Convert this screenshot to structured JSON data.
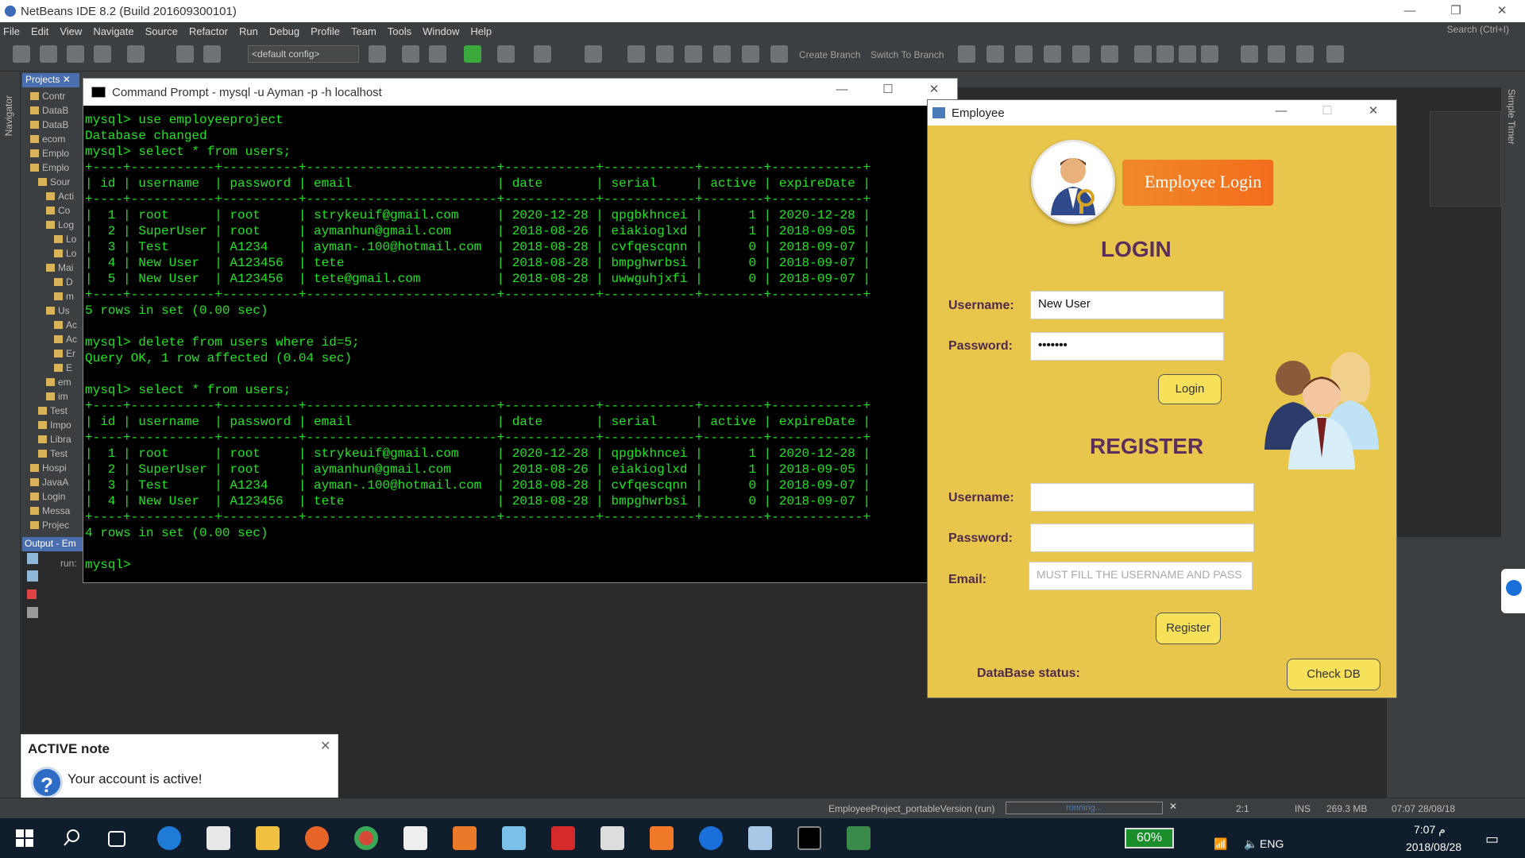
{
  "netbeans": {
    "title": "NetBeans IDE 8.2 (Build 201609300101)",
    "menu": [
      "File",
      "Edit",
      "View",
      "Navigate",
      "Source",
      "Refactor",
      "Run",
      "Debug",
      "Profile",
      "Team",
      "Tools",
      "Window",
      "Help"
    ],
    "search_placeholder": "Search (Ctrl+I)",
    "config": "<default config>",
    "create_branch": "Create Branch",
    "switch_branch": "Switch To Branch",
    "projects_tab": "Projects",
    "navigator": "Navigator",
    "output_tab": "Output - Em",
    "output_run": "run:",
    "simple_timer": "Simple Timer",
    "tree": [
      "Contr",
      "DataB",
      "DataB",
      "ecom",
      "Emplo",
      "Emplo",
      "Sour",
      "Acti",
      "Co",
      "Log",
      "Lo",
      "Lo",
      "Mai",
      "D",
      "m",
      "Us",
      "Ac",
      "Ac",
      "Er",
      "E",
      "em",
      "im",
      "Test",
      "Impo",
      "Libra",
      "Test",
      "Hospi",
      "JavaA",
      "Login",
      "Messa",
      "Projec"
    ],
    "status_project": "EmployeeProject_portableVersion (run)",
    "status_running": "running...",
    "status_pos": "2:1",
    "status_ins": "INS",
    "status_mem": "269.3 MB",
    "status_time": "07:07 28/08/18"
  },
  "cmd": {
    "title": "Command Prompt - mysql  -u Ayman -p -h localhost",
    "lines": [
      "mysql> use employeeproject",
      "Database changed",
      "mysql> select * from users;",
      "+----+-----------+----------+-------------------------+------------+------------+--------+------------+",
      "| id | username  | password | email                   | date       | serial     | active | expireDate |",
      "+----+-----------+----------+-------------------------+------------+------------+--------+------------+",
      "|  1 | root      | root     | strykeuif@gmail.com     | 2020-12-28 | qpgbkhncei |      1 | 2020-12-28 |",
      "|  2 | SuperUser | root     | aymanhun@gmail.com      | 2018-08-26 | eiakioglxd |      1 | 2018-09-05 |",
      "|  3 | Test      | A1234    | ayman-.100@hotmail.com  | 2018-08-28 | cvfqescqnn |      0 | 2018-09-07 |",
      "|  4 | New User  | A123456  | tete                    | 2018-08-28 | bmpghwrbsi |      0 | 2018-09-07 |",
      "|  5 | New User  | A123456  | tete@gmail.com          | 2018-08-28 | uwwguhjxfi |      0 | 2018-09-07 |",
      "+----+-----------+----------+-------------------------+------------+------------+--------+------------+",
      "5 rows in set (0.00 sec)",
      "",
      "mysql> delete from users where id=5;",
      "Query OK, 1 row affected (0.04 sec)",
      "",
      "mysql> select * from users;",
      "+----+-----------+----------+-------------------------+------------+------------+--------+------------+",
      "| id | username  | password | email                   | date       | serial     | active | expireDate |",
      "+----+-----------+----------+-------------------------+------------+------------+--------+------------+",
      "|  1 | root      | root     | strykeuif@gmail.com     | 2020-12-28 | qpgbkhncei |      1 | 2020-12-28 |",
      "|  2 | SuperUser | root     | aymanhun@gmail.com      | 2018-08-26 | eiakioglxd |      1 | 2018-09-05 |",
      "|  3 | Test      | A1234    | ayman-.100@hotmail.com  | 2018-08-28 | cvfqescqnn |      0 | 2018-09-07 |",
      "|  4 | New User  | A123456  | tete                    | 2018-08-28 | bmpghwrbsi |      0 | 2018-09-07 |",
      "+----+-----------+----------+-------------------------+------------+------------+--------+------------+",
      "4 rows in set (0.00 sec)",
      "",
      "mysql>"
    ]
  },
  "employee": {
    "title": "Employee",
    "banner": "Employee Login",
    "login_heading": "LOGIN",
    "username_label": "Username:",
    "password_label": "Password:",
    "login_username": "New User",
    "login_password": "•••••••",
    "login_button": "Login",
    "register_heading": "REGISTER",
    "reg_username_label": "Username:",
    "reg_password_label": "Password:",
    "email_label": "Email:",
    "email_placeholder": "MUST FILL THE USERNAME AND PASS",
    "register_button": "Register",
    "db_status_label": "DataBase status:",
    "check_db_button": "Check DB"
  },
  "notification": {
    "title": "ACTIVE note",
    "text": "Your account is active!",
    "icon": "?"
  },
  "taskbar": {
    "battery": "60%",
    "lang": "ENG",
    "time": "7:07 م",
    "date": "2018/08/28"
  }
}
